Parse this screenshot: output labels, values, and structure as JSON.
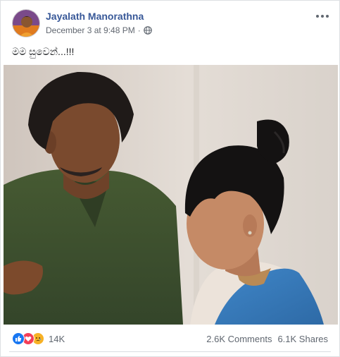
{
  "post": {
    "author": "Jayalath Manorathna",
    "timestamp": "December 3 at 9:48 PM",
    "privacy_icon": "globe-icon",
    "text": "මම සුවෙන්...!!!",
    "more_icon": "more-options-icon"
  },
  "engagement": {
    "reaction_icons": [
      "like-icon",
      "love-icon",
      "sad-icon"
    ],
    "reaction_count": "14K",
    "comments": "2.6K Comments",
    "shares": "6.1K Shares"
  },
  "colors": {
    "author_link": "#385898",
    "meta_text": "#616770",
    "like": "#1877f2",
    "love": "#f33e58",
    "sad": "#f7b125"
  }
}
